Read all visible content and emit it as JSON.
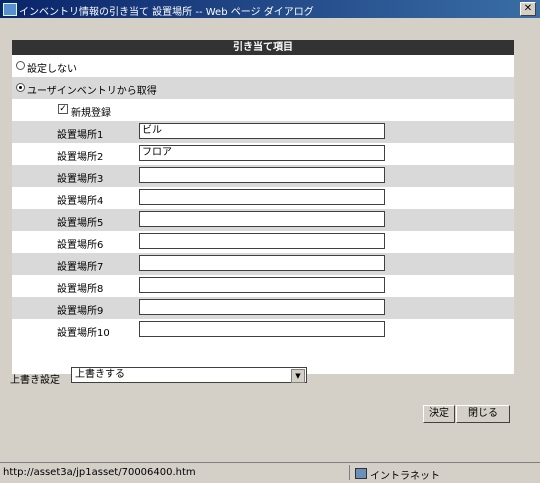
{
  "window": {
    "title": "インベントリ情報の引き当て  設置場所 -- Web ページ ダイアログ",
    "close": "✕"
  },
  "panel": {
    "header": "引き当て項目",
    "option_none": "設定しない",
    "option_user_inventory": "ユーザインベントリから取得",
    "new_registration": "新規登録",
    "new_registration_checked": true,
    "fields": [
      {
        "label": "設置場所1",
        "value": "ビル"
      },
      {
        "label": "設置場所2",
        "value": "フロア"
      },
      {
        "label": "設置場所3",
        "value": ""
      },
      {
        "label": "設置場所4",
        "value": ""
      },
      {
        "label": "設置場所5",
        "value": ""
      },
      {
        "label": "設置場所6",
        "value": ""
      },
      {
        "label": "設置場所7",
        "value": ""
      },
      {
        "label": "設置場所8",
        "value": ""
      },
      {
        "label": "設置場所9",
        "value": ""
      },
      {
        "label": "設置場所10",
        "value": ""
      }
    ]
  },
  "overwrite": {
    "label": "上書き設定",
    "selected": "上書きする"
  },
  "buttons": {
    "ok": "決定",
    "close": "閉じる"
  },
  "status": {
    "url": "http://asset3a/jp1asset/70006400.htm",
    "zone": "イントラネット"
  }
}
